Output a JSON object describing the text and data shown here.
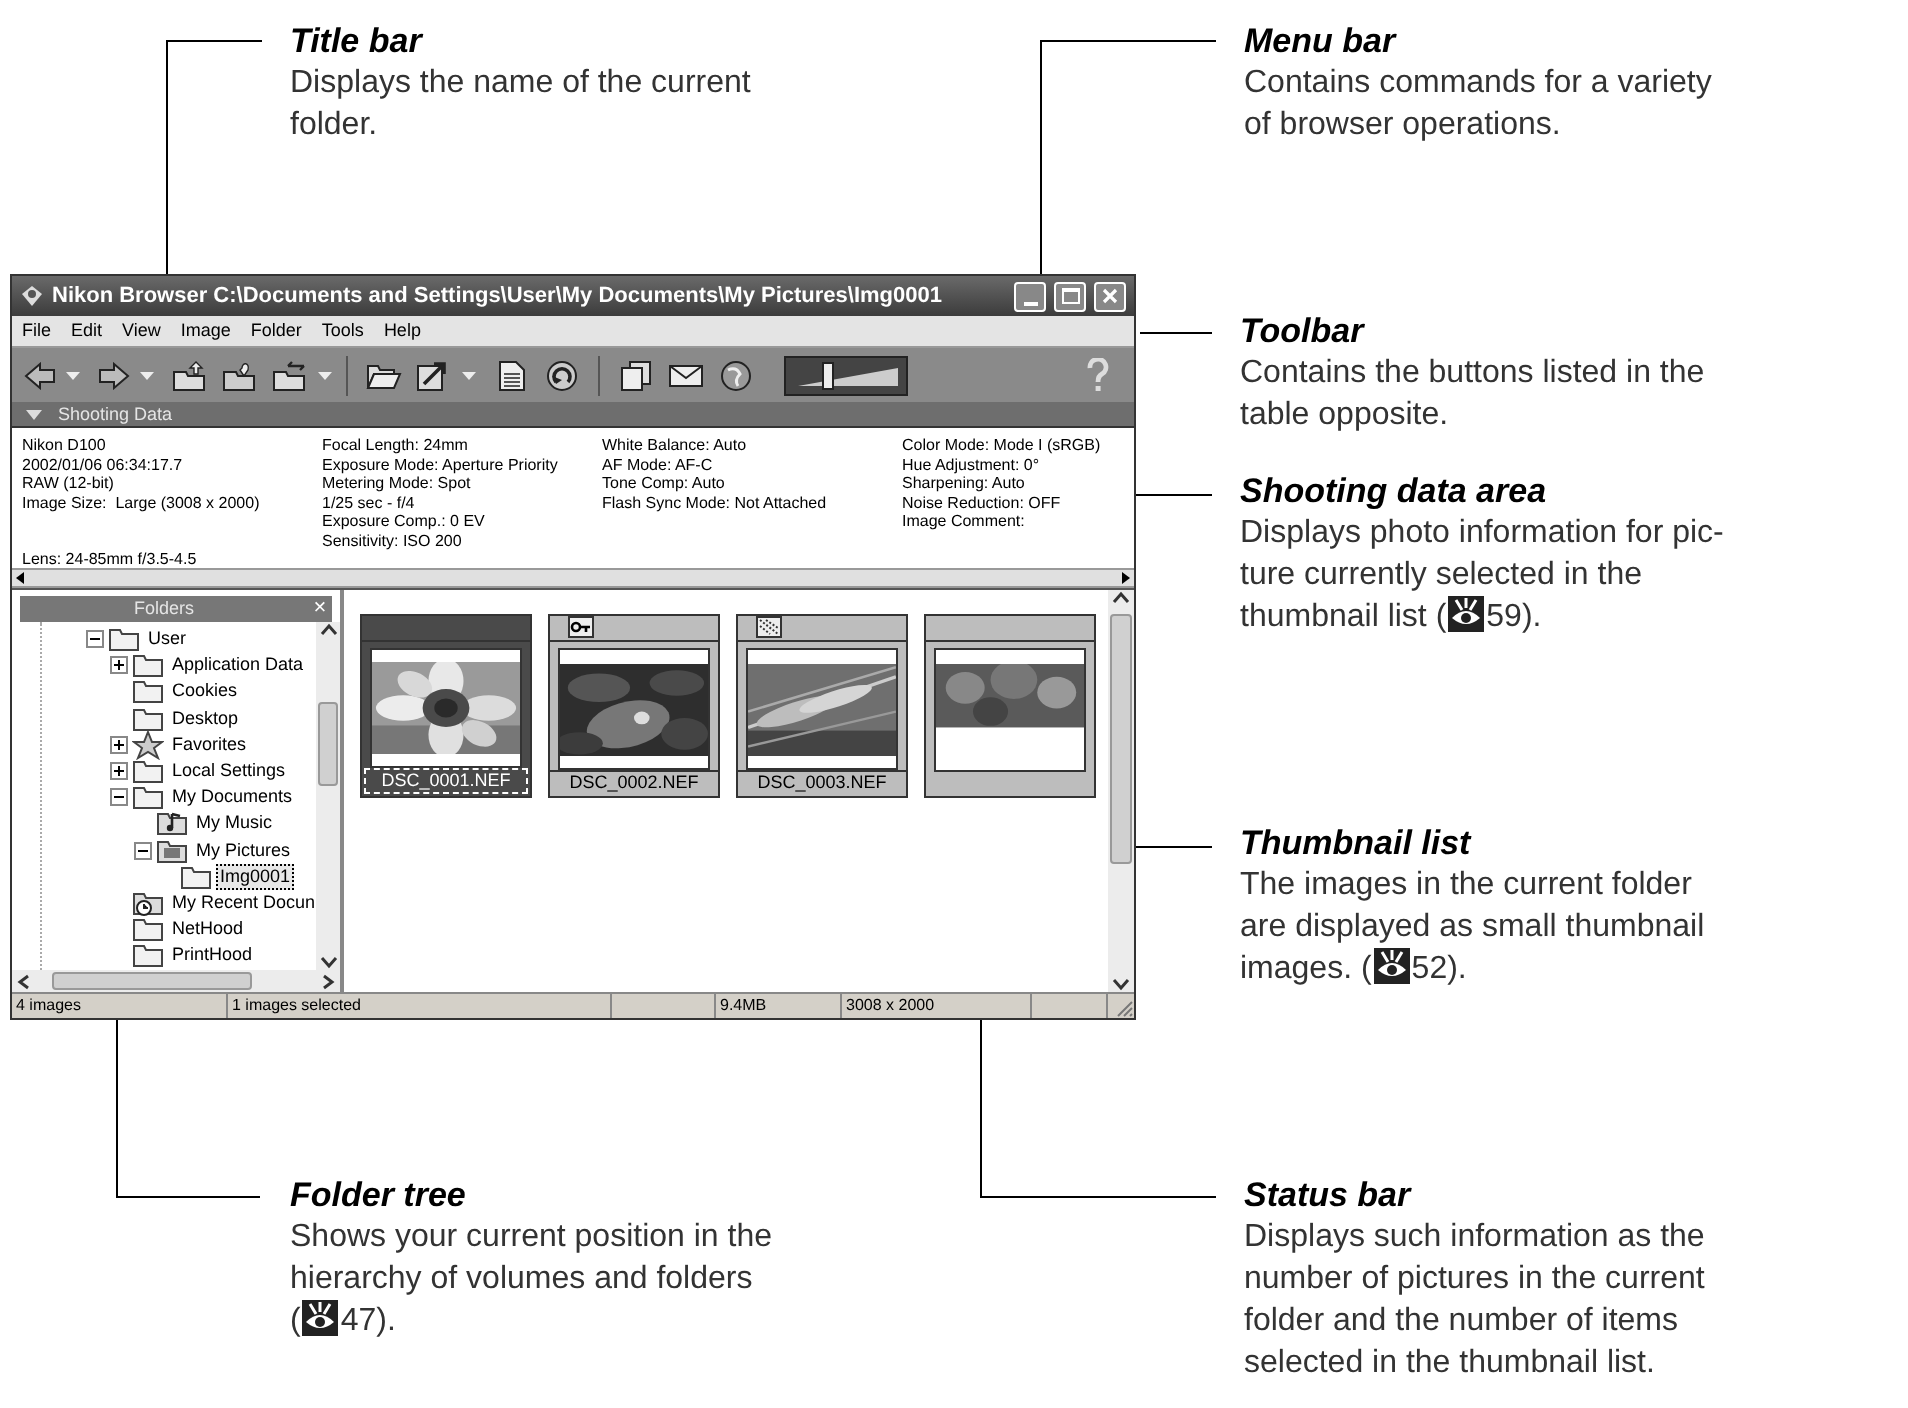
{
  "callouts": [
    {
      "kind": "title",
      "heading": "Title bar",
      "lines": [
        "Displays the name of the current",
        "folder."
      ]
    },
    {
      "kind": "menu",
      "heading": "Menu bar",
      "lines": [
        "Contains commands for a variety",
        "of browser operations."
      ]
    },
    {
      "kind": "toolbar",
      "heading": "Toolbar",
      "lines": [
        "Contains the buttons listed in the",
        "table opposite."
      ]
    },
    {
      "kind": "shooting",
      "heading": "Shooting data area",
      "lines": [
        "Displays photo information for pic-",
        "ture currently selected in the",
        "thumbnail list ("
      ],
      "page_ref": "59)."
    },
    {
      "kind": "thumbs",
      "heading": "Thumbnail list",
      "lines": [
        "The images in the current folder",
        "are displayed as small thumbnail",
        "images.  ("
      ],
      "page_ref": "52)."
    },
    {
      "kind": "tree",
      "heading": "Folder tree",
      "lines": [
        "Shows your current position in the",
        "hierarchy of volumes and folders",
        "("
      ],
      "page_ref": "47)."
    },
    {
      "kind": "status",
      "heading": "Status bar",
      "lines": [
        "Displays such information as the",
        "number of pictures in the current",
        "folder and the number of items",
        "selected in the thumbnail list."
      ]
    }
  ],
  "window": {
    "title": "Nikon Browser C:\\Documents and Settings\\User\\My Documents\\My Pictures\\Img0001",
    "menu": [
      "File",
      "Edit",
      "View",
      "Image",
      "Folder",
      "Tools",
      "Help"
    ],
    "thumbnail_size_slider": {
      "level": 0.3
    },
    "shooting_data": {
      "header": "Shooting Data",
      "columns": [
        [
          "Nikon D100",
          "2002/01/06 06:34:17.7",
          "RAW (12-bit)",
          "Image Size:  Large (3008 x 2000)"
        ],
        [
          "Focal Length: 24mm",
          "Exposure Mode: Aperture Priority",
          "Metering Mode: Spot",
          "1/25 sec - f/4",
          "Exposure Comp.: 0 EV",
          "Sensitivity: ISO 200"
        ],
        [
          "White Balance: Auto",
          "AF Mode: AF-C",
          "Tone Comp: Auto",
          "Flash Sync Mode: Not Attached"
        ],
        [
          "Color Mode: Mode I (sRGB)",
          "Hue Adjustment: 0°",
          "Sharpening: Auto",
          "Noise Reduction: OFF",
          "Image Comment:"
        ]
      ],
      "lens": "Lens: 24-85mm f/3.5-4.5"
    },
    "folders": {
      "title": "Folders",
      "close": "×",
      "tree": [
        {
          "label": "User",
          "kind": "folder",
          "expanded": true,
          "selected": false,
          "children": [
            {
              "label": "Application Data",
              "kind": "folder",
              "expanded": false,
              "selected": false
            },
            {
              "label": "Cookies",
              "kind": "folder",
              "selected": false
            },
            {
              "label": "Desktop",
              "kind": "folder",
              "selected": false
            },
            {
              "label": "Favorites",
              "kind": "star",
              "expanded": false,
              "selected": false
            },
            {
              "label": "Local Settings",
              "kind": "folder",
              "expanded": false,
              "selected": false
            },
            {
              "label": "My Documents",
              "kind": "folder",
              "expanded": true,
              "selected": false,
              "children": [
                {
                  "label": "My Music",
                  "kind": "music",
                  "selected": false
                },
                {
                  "label": "My Pictures",
                  "kind": "pictures",
                  "expanded": true,
                  "selected": false,
                  "children": [
                    {
                      "label": "Img0001",
                      "kind": "folder",
                      "selected": true
                    }
                  ]
                }
              ]
            },
            {
              "label": "My Recent Docun",
              "kind": "recent",
              "selected": false
            },
            {
              "label": "NetHood",
              "kind": "folder",
              "selected": false
            },
            {
              "label": "PrintHood",
              "kind": "folder",
              "selected": false
            }
          ]
        }
      ]
    },
    "thumbnails": [
      {
        "filename": "DSC_0001.NEF",
        "selected": true,
        "kind": "plain"
      },
      {
        "filename": "DSC_0002.NEF",
        "selected": false,
        "kind": "key"
      },
      {
        "filename": "DSC_0003.NEF",
        "selected": false,
        "kind": "pattern"
      },
      {
        "selected": false,
        "kind": "plain"
      }
    ],
    "status_bar": [
      "4 images",
      "1 images selected",
      "9.4MB",
      "3008 x 2000"
    ]
  }
}
